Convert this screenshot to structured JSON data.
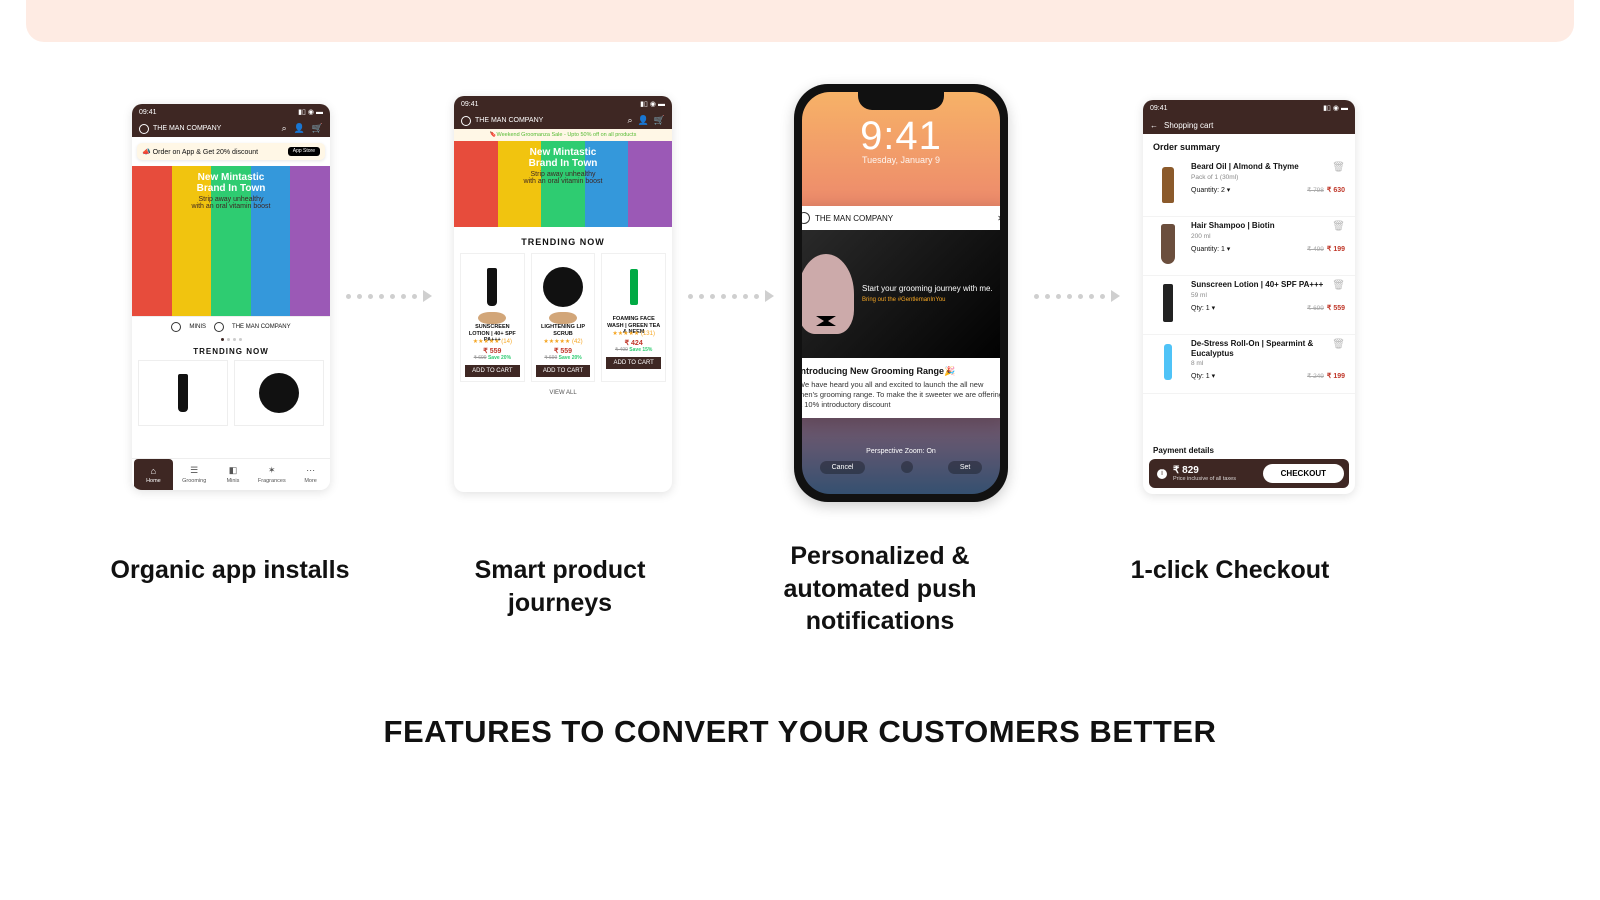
{
  "time": "09:41",
  "brand": "THE MAN COMPANY",
  "hero": {
    "line1": "New Mintastic",
    "line2": "Brand In Town",
    "sub1": "Strip away unhealthy",
    "sub2": "with an oral vitamin boost"
  },
  "p1": {
    "promo": "Order on App & Get 20% discount",
    "appstore": "App Store",
    "logos": [
      "MINIS",
      "THE MAN COMPANY"
    ],
    "trending": "TRENDING NOW",
    "nav": [
      "Home",
      "Grooming",
      "Minis",
      "Fragrances",
      "More"
    ]
  },
  "p2": {
    "sale": "Weekend Groomanza Sale - Upto 50% off on all products",
    "trending": "TRENDING NOW",
    "viewall": "VIEW ALL",
    "addtocart": "ADD TO CART",
    "cards": [
      {
        "name": "SUNSCREEN LOTION | 40+ SPF PA+++",
        "rating": "★★★★★ (14)",
        "price": "₹ 559",
        "old": "₹ 699",
        "save": "Save 20%"
      },
      {
        "name": "LIGHTENING LIP SCRUB",
        "rating": "★★★★★ (42)",
        "price": "₹ 559",
        "old": "₹ 699",
        "save": "Save 20%"
      },
      {
        "name": "FOAMING FACE WASH | GREEN TEA & NEEM",
        "rating": "★★★★★ (131)",
        "price": "₹ 424",
        "old": "₹ 499",
        "save": "Save 15%"
      }
    ]
  },
  "p3": {
    "time": "9:41",
    "date": "Tuesday, January 9",
    "brand": "THE MAN COMPANY",
    "imgline1": "Start your grooming journey with me.",
    "imgline2": "Bring out the #GentlemanInYou",
    "title": "Introducing New Grooming Range🎉",
    "body": "We have heard you all and excited to launch the all new men's grooming range. To make the it sweeter we are offering a 10% introductory discount",
    "zoom": "Perspective Zoom: On",
    "cancel": "Cancel",
    "set": "Set"
  },
  "p4": {
    "title": "Shopping cart",
    "order": "Order summary",
    "payment": "Payment details",
    "total": "₹ 829",
    "inc": "Price inclusive of all taxes",
    "checkout": "CHECKOUT",
    "items": [
      {
        "name": "Beard Oil | Almond & Thyme",
        "sub": "Pack of 1 (30ml)",
        "qty": "Quantity: 2 ▾",
        "old": "₹ 798",
        "new": "₹ 630"
      },
      {
        "name": "Hair Shampoo | Biotin",
        "sub": "200 ml",
        "qty": "Quantity: 1 ▾",
        "old": "₹ 499",
        "new": "₹ 199"
      },
      {
        "name": "Sunscreen Lotion | 40+ SPF PA+++",
        "sub": "59 ml",
        "qty": "Qty: 1 ▾",
        "old": "₹ 699",
        "new": "₹ 559"
      },
      {
        "name": "De-Stress Roll-On | Spearmint & Eucalyptus",
        "sub": "8 ml",
        "qty": "Qty: 1 ▾",
        "old": "₹ 249",
        "new": "₹ 199"
      }
    ]
  },
  "captions": {
    "c1": "Organic app installs",
    "c2": "Smart product journeys",
    "c3": "Personalized & automated push notifications",
    "c4": "1-click Checkout"
  },
  "tagline": "FEATURES TO CONVERT YOUR CUSTOMERS BETTER"
}
